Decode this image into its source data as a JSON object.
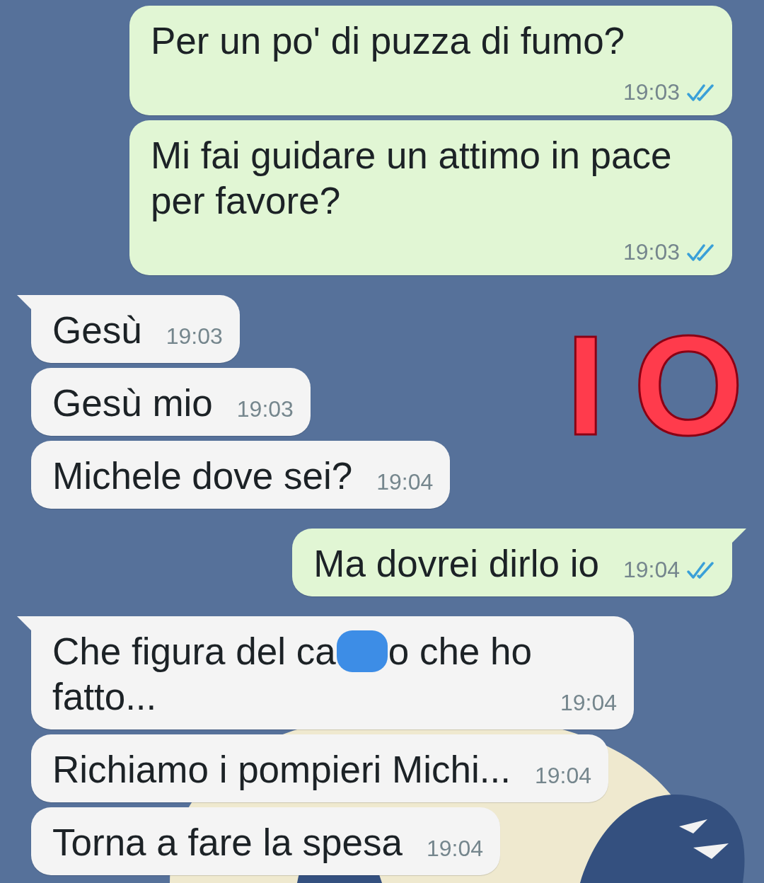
{
  "messages": [
    {
      "kind": "outgoing",
      "tail": false,
      "parts": [
        {
          "kind": "text",
          "text": "Per un po' di puzza di fumo?"
        }
      ],
      "time": "19:03",
      "read": true
    },
    {
      "kind": "outgoing",
      "tail": false,
      "parts": [
        {
          "kind": "text",
          "text": "Mi fai guidare un attimo in pace per favore?"
        }
      ],
      "time": "19:03",
      "read": true
    },
    {
      "kind": "incoming",
      "tail": true,
      "parts": [
        {
          "kind": "text",
          "text": "Gesù"
        }
      ],
      "time": "19:03"
    },
    {
      "kind": "incoming",
      "tail": false,
      "parts": [
        {
          "kind": "text",
          "text": "Gesù mio"
        }
      ],
      "time": "19:03"
    },
    {
      "kind": "incoming",
      "tail": false,
      "parts": [
        {
          "kind": "text",
          "text": "Michele dove sei?"
        }
      ],
      "time": "19:04"
    },
    {
      "kind": "outgoing",
      "tail": true,
      "parts": [
        {
          "kind": "text",
          "text": "Ma dovrei dirlo io"
        }
      ],
      "time": "19:04",
      "read": true
    },
    {
      "kind": "incoming",
      "tail": true,
      "parts": [
        {
          "kind": "text",
          "text": "Che figura del ca"
        },
        {
          "kind": "redaction"
        },
        {
          "kind": "text",
          "text": "o che ho"
        },
        {
          "kind": "text",
          "text": "fatto..."
        }
      ],
      "time": "19:04"
    },
    {
      "kind": "incoming",
      "tail": false,
      "parts": [
        {
          "kind": "text",
          "text": "Richiamo i pompieri Michi..."
        }
      ],
      "time": "19:04"
    },
    {
      "kind": "incoming",
      "tail": false,
      "parts": [
        {
          "kind": "text",
          "text": "Torna a fare la spesa"
        }
      ],
      "time": "19:04"
    }
  ],
  "annotation": {
    "text": "IO"
  }
}
